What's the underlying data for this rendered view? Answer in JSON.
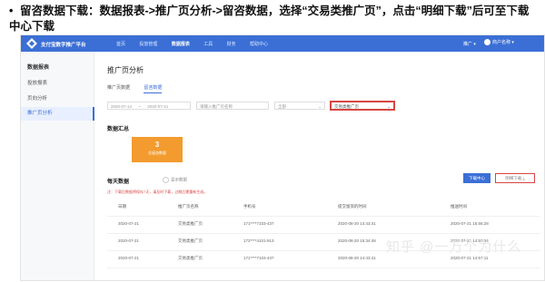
{
  "caption": {
    "bullet": "•",
    "text": "留咨数据下载：数据报表->推广页分析->留咨数据，选择“交易类推广页”，点击“明细下载”后可至下载中心下载"
  },
  "topbar": {
    "brand": "支付宝数字推广平台",
    "nav": [
      "首页",
      "投放管理",
      "数据报表",
      "工具",
      "财务",
      "帮助中心"
    ],
    "active_nav_index": 2,
    "right_menu": "推广 ▾",
    "user": "商户名称 ▾"
  },
  "sidebar": {
    "title": "数据报表",
    "items": [
      "投放报表",
      "页向分析",
      "推广页分析"
    ],
    "active_index": 2
  },
  "main": {
    "page_title": "推广页分析",
    "tabs": [
      "推广页数据",
      "留咨数据"
    ],
    "active_tab_index": 1,
    "filters": {
      "date_start": "2020-07-14",
      "date_end": "2020-07-21",
      "date_sep": "~",
      "name_placeholder": "请输入推广页名称",
      "select_all": "全部",
      "page_type": "交易类推广页"
    },
    "summary_title": "数据汇总",
    "summary_card": {
      "value": "3",
      "label": "总留咨数量"
    },
    "daily_title": "每天数据",
    "toggle_label": "显示数据",
    "download_center_btn": "下载中心",
    "detail_download_btn": "明细下载",
    "notice": "注：下载后数据将保存7天，请及时下载，过期后需重新生成。",
    "table": {
      "headers": [
        "日期",
        "推广页名称",
        "手机号",
        "提交留资的时间",
        "推送时间"
      ],
      "rows": [
        [
          "2020-07-21",
          "交易类推广页",
          "171****7103-437",
          "2020-08-20 14:43:41",
          "2020-07-21 15:56:28"
        ],
        [
          "2020-07-21",
          "交易类推广页",
          "172****4101-913",
          "2020-08-20 15:34:48",
          "2020-07-21 14:50:34"
        ],
        [
          "2020-07-21",
          "交易类推广页",
          "171****7103-437",
          "2020-08-20 14:43:41",
          "2020-07-21 14:57:11"
        ]
      ]
    }
  },
  "watermark": "知乎 @一万个为什么"
}
